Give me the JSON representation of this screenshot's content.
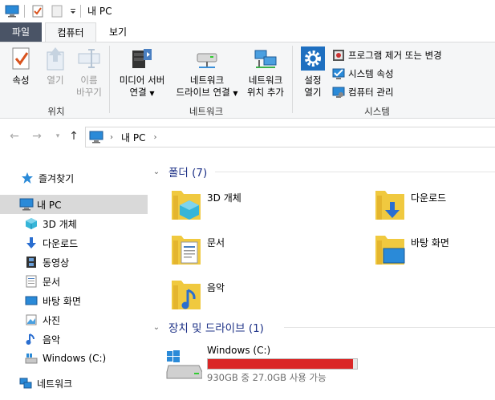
{
  "title_bar": {
    "title": "내 PC"
  },
  "ribbon_tabs": {
    "file": "파일",
    "computer": "컴퓨터",
    "view": "보기"
  },
  "ribbon": {
    "location": {
      "properties": "속성",
      "open": "열기",
      "rename_1": "이름",
      "rename_2": "바꾸기",
      "label": "위치"
    },
    "network": {
      "media_1": "미디어 서버",
      "media_2": "연결",
      "map_1": "네트워크",
      "map_2": "드라이브 연결",
      "add_1": "네트워크",
      "add_2": "위치 추가",
      "label": "네트워크"
    },
    "system": {
      "settings_1": "설정",
      "settings_2": "열기",
      "uninstall": "프로그램 제거 또는 변경",
      "sys_props": "시스템 속성",
      "manage": "컴퓨터 관리",
      "label": "시스템"
    }
  },
  "address": {
    "crumb": "내 PC"
  },
  "nav": {
    "quick_access": "즐겨찾기",
    "this_pc": "내 PC",
    "items": [
      "3D 개체",
      "다운로드",
      "동영상",
      "문서",
      "바탕 화면",
      "사진",
      "음악",
      "Windows (C:)"
    ],
    "network": "네트워크"
  },
  "content": {
    "folders_header": "폴더 (7)",
    "folders": [
      "3D 개체",
      "다운로드",
      "문서",
      "바탕 화면",
      "음악"
    ],
    "drives_header": "장치 및 드라이브 (1)",
    "drive": {
      "name": "Windows (C:)",
      "space": "930GB 중 27.0GB 사용 가능",
      "used_fraction": 0.971
    }
  },
  "colors": {
    "accent": "#1e3287",
    "drive_bar": "#da2626",
    "folder": "#f0c93f"
  }
}
